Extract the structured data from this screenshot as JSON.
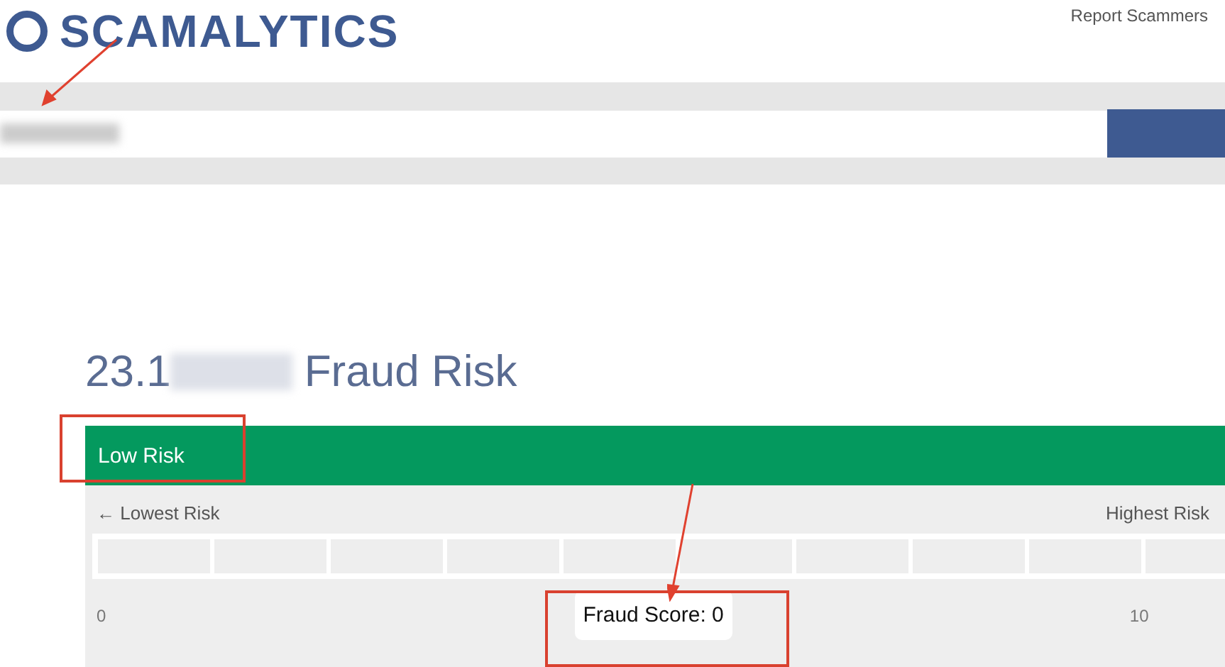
{
  "header": {
    "logo": "SCAMALYTICS",
    "nav_link": "Report Scammers"
  },
  "result": {
    "title_prefix": "23.1",
    "title_suffix": "Fraud Risk",
    "risk_label": "Low Risk",
    "scale_left": "← Lowest Risk",
    "scale_right": "Highest Risk",
    "scale_min": "0",
    "score": "Fraud Score: 0",
    "scale_max": "10"
  }
}
